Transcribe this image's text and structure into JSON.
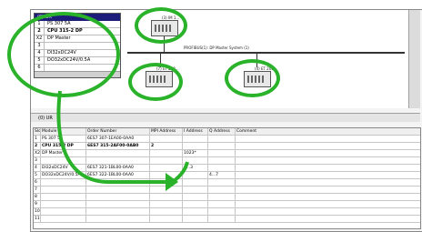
{
  "rack": {
    "title": "(0) UR",
    "rows": [
      {
        "slot": "1",
        "module": "PS 307 5A",
        "bold": false
      },
      {
        "slot": "2",
        "module": "CPU 315-2 DP",
        "bold": true
      },
      {
        "slot": "X2",
        "module": "DP Master",
        "bold": false
      },
      {
        "slot": "3",
        "module": "",
        "bold": false
      },
      {
        "slot": "4",
        "module": "DI32xDC24V",
        "bold": false
      },
      {
        "slot": "5",
        "module": "DO32xDC24V/0.5A",
        "bold": false
      },
      {
        "slot": "6",
        "module": "",
        "bold": false
      }
    ]
  },
  "network": {
    "bus_label": "PROFIBUS(1): DP Master System (1)",
    "stations": [
      {
        "label": "(3) IM 1..."
      },
      {
        "label": "(7) ET 200..."
      },
      {
        "label": "(4) ET 200..."
      }
    ]
  },
  "lower": {
    "title": "(0) UR",
    "columns": [
      "Slot",
      "Module",
      "Order Number",
      "MPI Address",
      "I Address",
      "Q Address",
      "Comment"
    ],
    "rows": [
      [
        "1",
        "PS 307 5A",
        "6ES7 307-1EA00-0AA0",
        "",
        "",
        "",
        ""
      ],
      [
        "2",
        "CPU 315-2 DP",
        "6ES7 315-2AF00-0AB0",
        "2",
        "",
        "",
        ""
      ],
      [
        "X2",
        "DP Master",
        "",
        "",
        "1023*",
        "",
        ""
      ],
      [
        "3",
        "",
        "",
        "",
        "",
        "",
        ""
      ],
      [
        "4",
        "DI32xDC24V",
        "6ES7 321-1BL00-0AA0",
        "",
        "0...3",
        "",
        ""
      ],
      [
        "5",
        "DO32xDC24V/0.5A",
        "6ES7 322-1BL00-0AA0",
        "",
        "",
        "4...7",
        ""
      ],
      [
        "6",
        "",
        "",
        "",
        "",
        "",
        ""
      ],
      [
        "7",
        "",
        "",
        "",
        "",
        "",
        ""
      ],
      [
        "8",
        "",
        "",
        "",
        "",
        "",
        ""
      ],
      [
        "9",
        "",
        "",
        "",
        "",
        "",
        ""
      ],
      [
        "10",
        "",
        "",
        "",
        "",
        "",
        ""
      ],
      [
        "11",
        "",
        "",
        "",
        "",
        "",
        ""
      ]
    ]
  },
  "colors": {
    "highlight": "#2ab32a"
  }
}
